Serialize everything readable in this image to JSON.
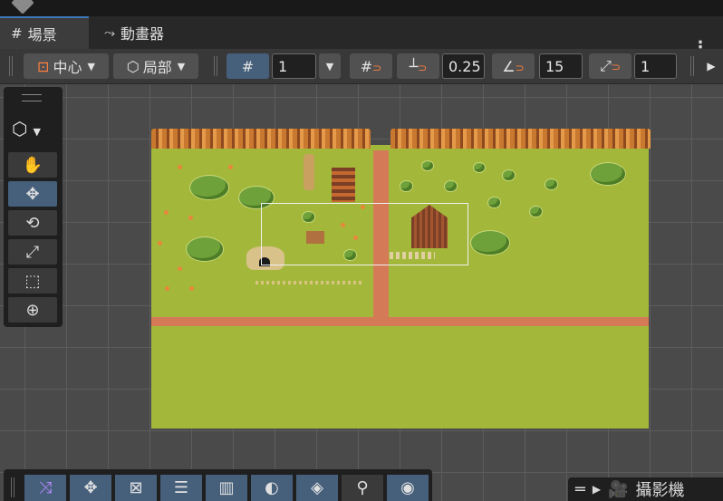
{
  "tabs": [
    {
      "label": "場景",
      "icon": "#"
    },
    {
      "label": "動畫器",
      "icon": "⤳"
    }
  ],
  "toolbar": {
    "pivot_label": "中心",
    "space_label": "局部",
    "grid_value": "1",
    "snap_value": "0.25",
    "rotate_snap_value": "15",
    "scale_snap_value": "1"
  },
  "camera_overlay": {
    "label": "攝影機"
  },
  "colors": {
    "accent": "#46607c",
    "grass": "#a3b83a",
    "road": "#d47a56"
  }
}
